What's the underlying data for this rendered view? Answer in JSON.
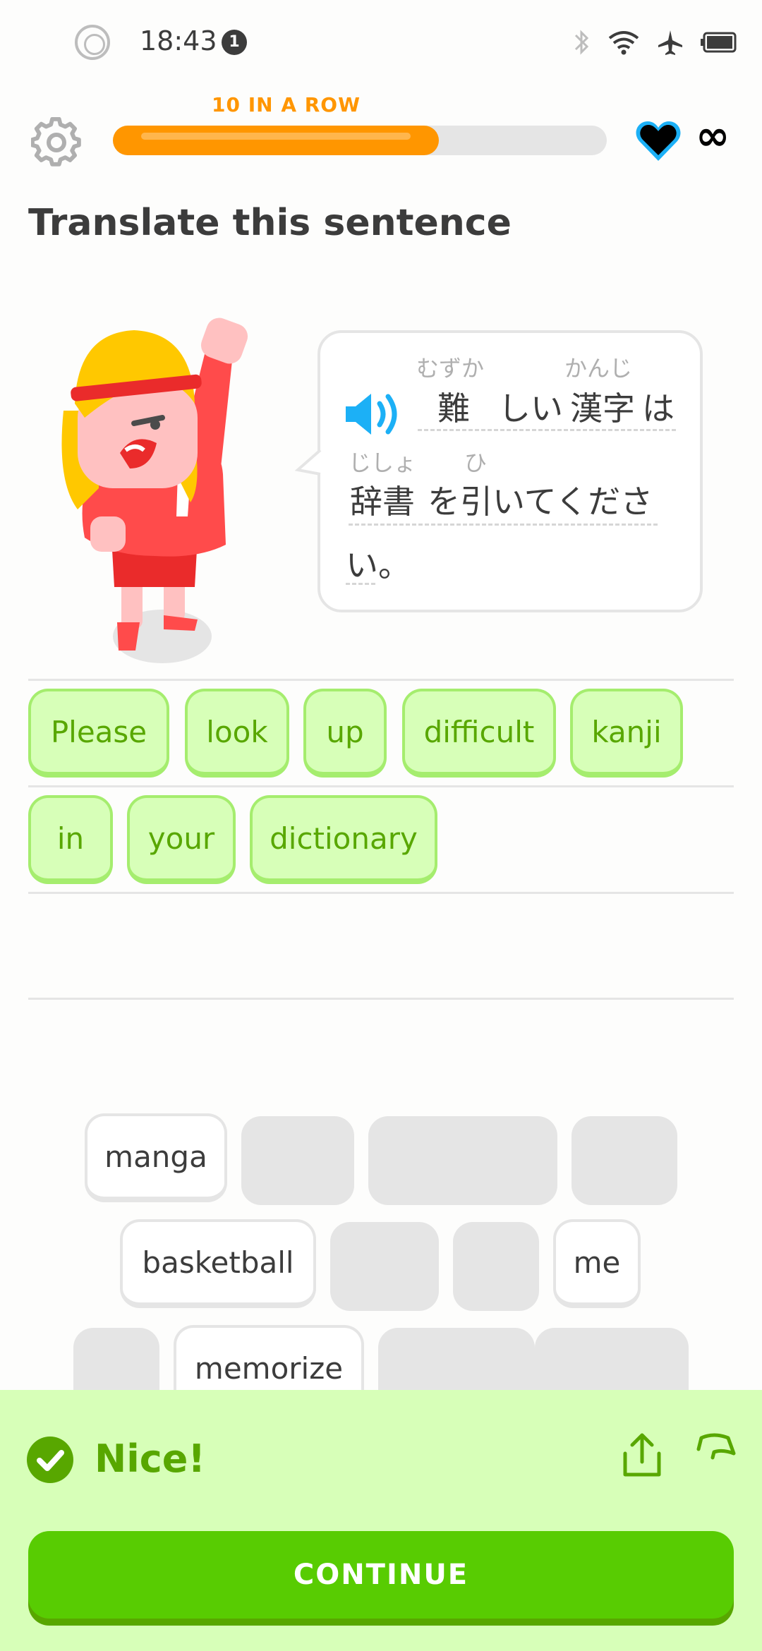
{
  "status_bar": {
    "time": "18:43",
    "notification_count": "1",
    "icons": [
      "bluetooth-icon",
      "wifi-icon",
      "airplane-icon",
      "battery-icon"
    ]
  },
  "header": {
    "streak_label": "10 IN A ROW",
    "progress_fraction": 0.66,
    "lives": "∞"
  },
  "prompt": {
    "title": "Translate this sentence"
  },
  "sentence": {
    "tokens": [
      {
        "text": "難",
        "reading": "むずか"
      },
      {
        "text": "しい"
      },
      {
        "text": "漢字",
        "reading": "かんじ"
      },
      {
        "text": "は"
      },
      {
        "text": "辞書",
        "reading": "じしょ"
      },
      {
        "text": "を"
      },
      {
        "text": "引",
        "reading": "ひ"
      },
      {
        "text": "いてくださ"
      },
      {
        "text": "い。"
      }
    ]
  },
  "answer_words": [
    "Please",
    "look",
    "up",
    "difficult",
    "kanji",
    "in",
    "your",
    "dictionary"
  ],
  "word_bank": [
    "manga",
    "basketball",
    "me",
    "memorize"
  ],
  "feedback": {
    "message": "Nice!",
    "continue_label": "CONTINUE"
  },
  "colors": {
    "accent_green": "#58CC02",
    "feedback_bg": "#D7FFB8",
    "streak_orange": "#FF9600",
    "heart_outline": "#1CB0F6"
  }
}
